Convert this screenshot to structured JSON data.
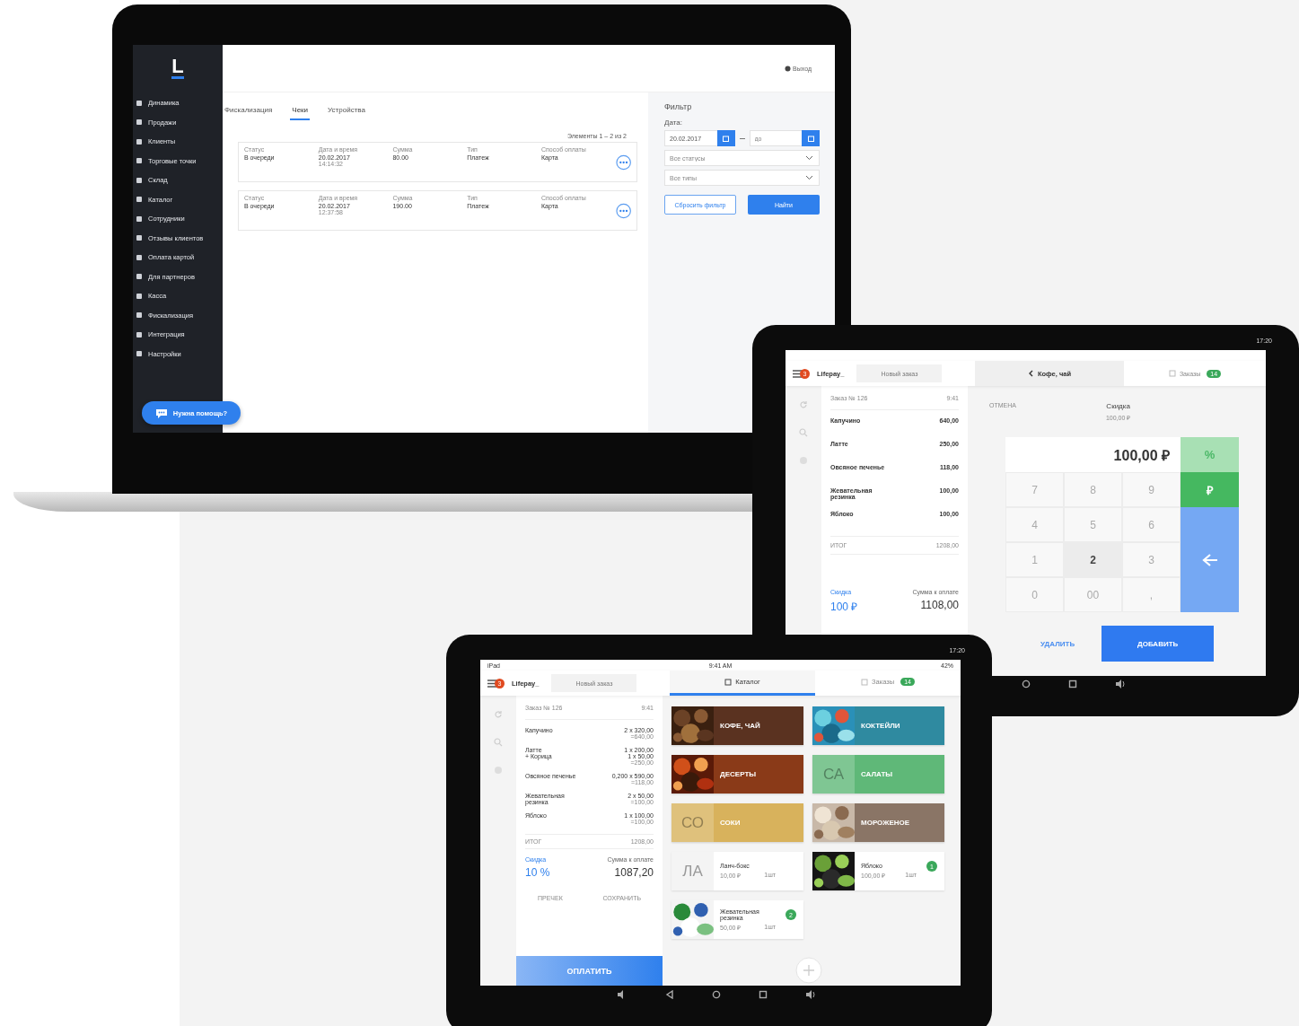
{
  "laptop": {
    "logo": "L",
    "sidebar": {
      "items": [
        {
          "label": "Динамика"
        },
        {
          "label": "Продажи"
        },
        {
          "label": "Клиенты"
        },
        {
          "label": "Торговые точки"
        },
        {
          "label": "Склад"
        },
        {
          "label": "Каталог"
        },
        {
          "label": "Сотрудники"
        },
        {
          "label": "Отзывы клиентов"
        },
        {
          "label": "Оплата картой"
        },
        {
          "label": "Для партнеров"
        },
        {
          "label": "Касса"
        },
        {
          "label": "Фискализация"
        },
        {
          "label": "Интеграция"
        },
        {
          "label": "Настройки"
        }
      ]
    },
    "help_button": "Нужна помощь?",
    "logout": "Выход",
    "tabs": [
      {
        "label": "Фискализация",
        "selected": false
      },
      {
        "label": "Чеки",
        "selected": true
      },
      {
        "label": "Устройства",
        "selected": false
      }
    ],
    "pagination": "Элементы 1 – 2 из 2",
    "receipts": [
      {
        "status_label": "Статус",
        "status": "В очереди",
        "date_label": "Дата и время",
        "date": "20.02.2017",
        "time": "14:14:32",
        "sum_label": "Сумма",
        "sum": "80.00",
        "type_label": "Тип",
        "type": "Платеж",
        "payment_label": "Способ оплаты",
        "payment": "Карта"
      },
      {
        "status_label": "Статус",
        "status": "В очереди",
        "date_label": "Дата и время",
        "date": "20.02.2017",
        "time": "12:37:58",
        "sum_label": "Сумма",
        "sum": "190.00",
        "type_label": "Тип",
        "type": "Платеж",
        "payment_label": "Способ оплаты",
        "payment": "Карта"
      }
    ],
    "filter": {
      "title": "Фильтр",
      "date_label": "Дата:",
      "date_from": "20.02.2017",
      "date_to": {
        "placeholder": "до"
      },
      "status_select": {
        "placeholder": "Все статусы"
      },
      "type_select": {
        "placeholder": "Все типы"
      },
      "reset_button": "Сбросить фильтр",
      "find_button": "Найти"
    }
  },
  "tablet_discount": {
    "status_time": "17:20",
    "menu_badge": "3",
    "brand": "Lifepay_",
    "new_order": "Новый заказ",
    "back": "Кофе, чай",
    "orders_tab": {
      "label": "Заказы",
      "badge": "14"
    },
    "order": {
      "title": "Заказ № 126",
      "time": "9:41",
      "items": [
        {
          "name": "Капучино",
          "amount": "640,00"
        },
        {
          "name": "Латте",
          "amount": "250,00"
        },
        {
          "name": "Овсяное печенье",
          "amount": "118,00"
        },
        {
          "name": "Жевательная резинка",
          "amount": "100,00"
        },
        {
          "name": "Яблоко",
          "amount": "100,00"
        }
      ],
      "total_label": "ИТОГ",
      "total": "1208,00",
      "discount_label": "Скидка",
      "discount": "100 ₽",
      "due_label": "Сумма к оплате",
      "due": "1108,00"
    },
    "keypad": {
      "cancel": "ОТМЕНА",
      "title": "Скидка",
      "subtitle": "100,00 ₽",
      "display": "100,00 ₽",
      "modes": [
        {
          "label": "%",
          "selected": false
        },
        {
          "label": "₽",
          "selected": true
        }
      ],
      "keys": [
        {
          "label": "7",
          "pressed": false
        },
        {
          "label": "8",
          "pressed": false
        },
        {
          "label": "9",
          "pressed": false
        },
        {
          "label": "4",
          "pressed": false
        },
        {
          "label": "5",
          "pressed": false
        },
        {
          "label": "6",
          "pressed": false
        },
        {
          "label": "1",
          "pressed": false
        },
        {
          "label": "2",
          "pressed": true
        },
        {
          "label": "3",
          "pressed": false
        },
        {
          "label": "0",
          "pressed": false
        },
        {
          "label": "00",
          "pressed": false
        },
        {
          "label": ",",
          "pressed": false
        }
      ],
      "delete_button": "УДАЛИТЬ",
      "add_button": "ДОБАВИТЬ"
    }
  },
  "tablet_catalog": {
    "status_time": "17:20",
    "status_bar": {
      "device": "iPad",
      "time": "9:41 AM",
      "battery": "42%"
    },
    "menu_badge": "3",
    "brand": "Lifepay_",
    "new_order": "Новый заказ",
    "tabs": [
      {
        "label": "Каталог",
        "selected": true
      },
      {
        "label": "Заказы",
        "selected": false,
        "badge": "14"
      }
    ],
    "order": {
      "title": "Заказ № 126",
      "time": "9:41",
      "items": [
        {
          "name": [
            "Капучино"
          ],
          "qty": [
            "2 x 320,00"
          ],
          "amount": "=640,00"
        },
        {
          "name": [
            "Латте",
            "+ Корица"
          ],
          "qty": [
            "1 x 200,00",
            "1 x 50,00"
          ],
          "amount": "=250,00"
        },
        {
          "name": [
            "Овсяное печенье"
          ],
          "qty": [
            "0,200 x 590,00"
          ],
          "amount": "=118,00"
        },
        {
          "name": [
            "Жевательная",
            "резинка"
          ],
          "qty": [
            "2 x 50,00"
          ],
          "amount": "=100,00"
        },
        {
          "name": [
            "Яблоко"
          ],
          "qty": [
            "1 x 100,00"
          ],
          "amount": "=100,00"
        }
      ],
      "total_label": "ИТОГ",
      "total": "1208,00",
      "discount_label": "Скидка",
      "discount": "10 %",
      "due_label": "Сумма к оплате",
      "due": "1087,20",
      "precheck_button": "ПРЕЧЕК",
      "save_button": "СОХРАНИТЬ",
      "pay_button": "ОПЛАТИТЬ"
    },
    "categories": [
      {
        "label": "КОФЕ, ЧАЙ",
        "color": "#5a3220"
      },
      {
        "label": "КОКТЕЙЛИ",
        "color": "#2f8aa0"
      },
      {
        "label": "ДЕСЕРТЫ",
        "color": "#8a3a18"
      },
      {
        "label": "САЛАТЫ",
        "kind": "letters",
        "letters": "СА",
        "color": "#5fb878"
      },
      {
        "label": "СОКИ",
        "kind": "letters",
        "letters": "СО",
        "color": "#d8b25c"
      },
      {
        "label": "МОРОЖЕНОЕ",
        "color": "#8a7566"
      }
    ],
    "products": [
      {
        "name": "Ланч-бокс",
        "kind": "letters",
        "letters": "ЛА",
        "price": "10,00 ₽",
        "unit": "1шт"
      },
      {
        "name": "Яблоко",
        "price": "100,00 ₽",
        "unit": "1шт",
        "count": "1"
      },
      {
        "name": "Жевательная резинка",
        "price": "50,00 ₽",
        "unit": "1шт",
        "count": "2"
      }
    ]
  }
}
